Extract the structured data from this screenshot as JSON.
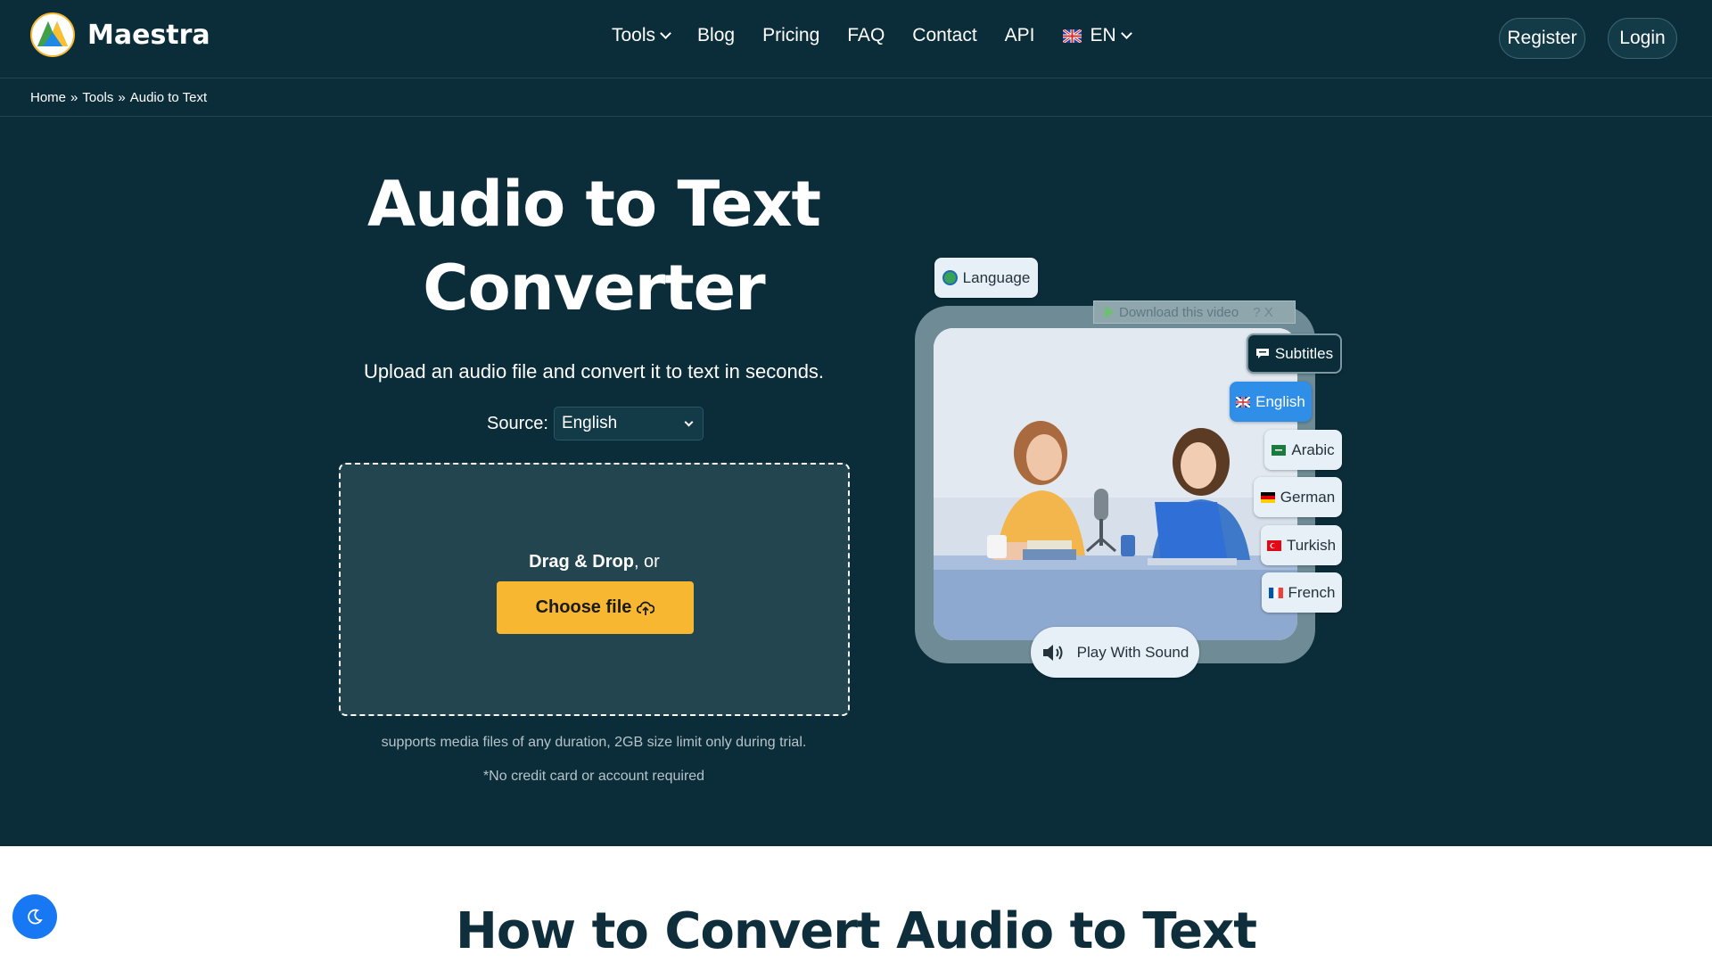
{
  "brand": {
    "name": "Maestra"
  },
  "nav": {
    "items": [
      "Tools",
      "Blog",
      "Pricing",
      "FAQ",
      "Contact",
      "API"
    ],
    "language": "EN",
    "register": "Register",
    "login": "Login"
  },
  "breadcrumb": [
    "Home",
    "»",
    "Tools",
    "»",
    "Audio to Text"
  ],
  "hero": {
    "title_line1": "Audio to Text",
    "title_line2": "Converter",
    "subtitle": "Upload an audio file and convert it to text in seconds.",
    "source_label": "Source:",
    "source_value": "English",
    "drag_bold": "Drag & Drop",
    "drag_rest": ", or",
    "choose_file": "Choose file",
    "note1": "supports media files of any duration, 2GB size limit only during trial.",
    "note2": "*No credit card or account required"
  },
  "illustration": {
    "language_chip": "Language",
    "download_bar": "Download this video",
    "download_controls": "? X",
    "subtitles_chip": "Subtitles",
    "languages": [
      "English",
      "Arabic",
      "German",
      "Turkish",
      "French"
    ],
    "play_button": "Play With Sound"
  },
  "section": {
    "title": "How to Convert Audio to Text"
  },
  "colors": {
    "background": "#0b2d3a",
    "accent": "#f7b731",
    "selected": "#2f8ee8",
    "toggle": "#1877f2"
  },
  "icons": [
    "chevron-down-icon",
    "upload-cloud-icon",
    "speaker-icon",
    "moon-icon",
    "globe-icon",
    "subtitles-icon"
  ]
}
